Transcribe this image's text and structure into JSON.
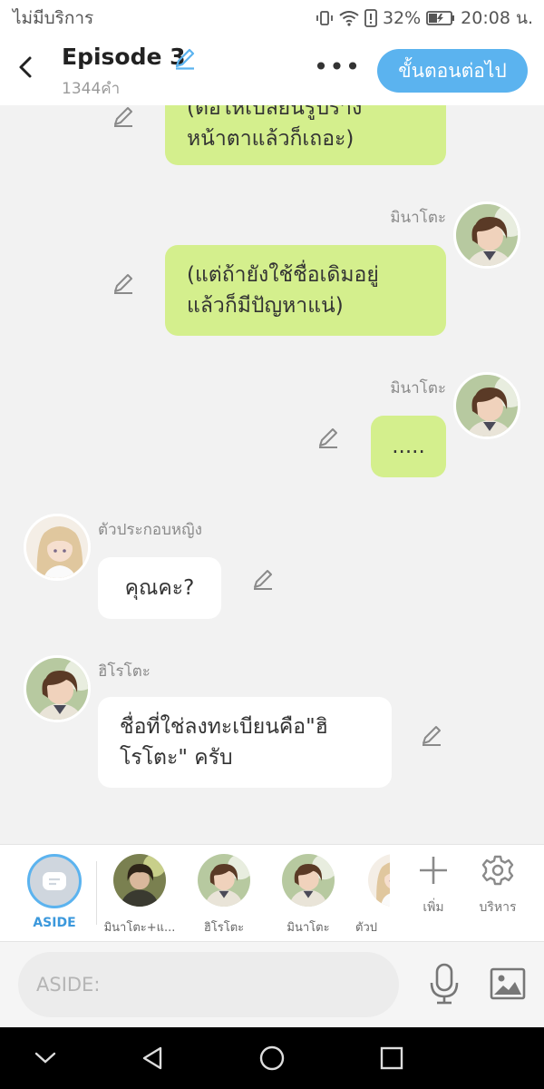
{
  "status_bar": {
    "carrier": "ไม่มีบริการ",
    "battery": "32%",
    "time": "20:08 น."
  },
  "header": {
    "title": "Episode 3",
    "word_count": "1344คำ",
    "more_label": "•••",
    "next_button": "ขั้นตอนต่อไป"
  },
  "messages": [
    {
      "side": "right",
      "line1": "(ต่อให้เปลี่ยนรูปร่าง",
      "line2": "หน้าตาแล้วก็เถอะ)"
    },
    {
      "side": "right",
      "speaker": "มินาโตะ",
      "line1": "(แต่ถ้ายังใช้ชื่อเดิมอยู่",
      "line2": "แล้วก็มีปัญหาแน่)"
    },
    {
      "side": "right",
      "speaker": "มินาโตะ",
      "text": "....."
    },
    {
      "side": "left",
      "speaker": "ตัวประกอบหญิง",
      "text": "คุณคะ?"
    },
    {
      "side": "left",
      "speaker": "ฮิโรโตะ",
      "line1": "ชื่อที่ใช่ลงทะเบียนคือ\"ฮิ",
      "line2": "โรโตะ\" ครับ"
    }
  ],
  "character_bar": {
    "aside_label": "ASIDE",
    "characters": [
      {
        "label": "มินาโตะ+แ..."
      },
      {
        "label": "ฮิโรโตะ"
      },
      {
        "label": "มินาโตะ"
      },
      {
        "label": "ตัวป"
      }
    ],
    "add_label": "เพิ่ม",
    "manage_label": "บริหาร"
  },
  "input": {
    "placeholder": "ASIDE:",
    "value": ""
  },
  "colors": {
    "accent": "#5bb3ef",
    "right_bubble": "#d4ef8d",
    "left_bubble": "#ffffff",
    "chat_bg": "#f2f2f2"
  }
}
